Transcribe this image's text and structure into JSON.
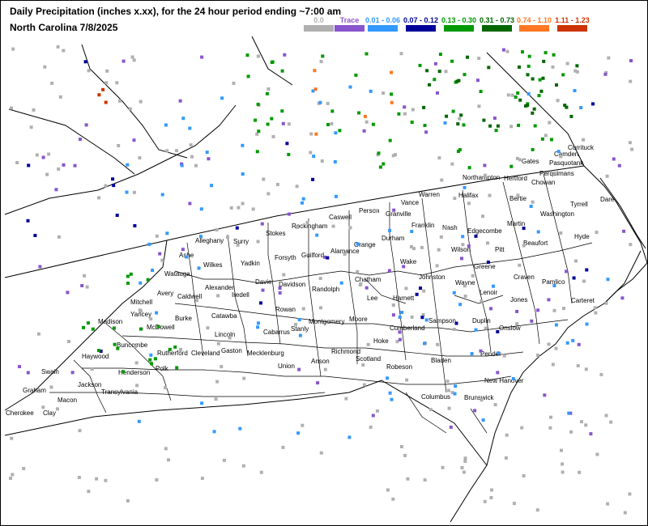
{
  "title": "Daily Precipitation (inches  x.xx),  for the 24 hour period ending ~7:00 am",
  "subtitle": "North Carolina 7/8/2025",
  "legend": [
    {
      "label": "0.0",
      "color": "#b0b0b0",
      "label_color": "#b0b0b0"
    },
    {
      "label": "Trace",
      "color": "#8855cc",
      "label_color": "#8855cc"
    },
    {
      "label": "0.01 - 0.06",
      "color": "#3399ff",
      "label_color": "#3399ff"
    },
    {
      "label": "0.07 - 0.12",
      "color": "#000099",
      "label_color": "#000099"
    },
    {
      "label": "0.13 - 0.30",
      "color": "#009900",
      "label_color": "#009900"
    },
    {
      "label": "0.31 - 0.73",
      "color": "#006600",
      "label_color": "#006600"
    },
    {
      "label": "0.74 - 1.10",
      "color": "#ff7722",
      "label_color": "#ff7722"
    },
    {
      "label": "1.11 - 1.23",
      "color": "#cc3300",
      "label_color": "#cc3300"
    }
  ],
  "counties": [
    "Currituck",
    "Camden",
    "Pasquotank",
    "Gates",
    "Perquimans",
    "Chowan",
    "Northampton",
    "Hertford",
    "Dare",
    "Warren",
    "Halifax",
    "Bertie",
    "Tyrrell",
    "Vance",
    "Washington",
    "Person",
    "Granville",
    "Caswell",
    "Rockingham",
    "Stokes",
    "Martin",
    "Franklin",
    "Nash",
    "Edgecombe",
    "Hyde",
    "Alleghany",
    "Surry",
    "Ashe",
    "Beaufort",
    "Durham",
    "Orange",
    "Alamance",
    "Guilford",
    "Forsyth",
    "Yadkin",
    "Wilkes",
    "Pitt",
    "Wilson",
    "Wake",
    "Watauga",
    "Greene",
    "Chatham",
    "Johnston",
    "Craven",
    "Pamlico",
    "Davie",
    "Davidson",
    "Avery",
    "Caldwell",
    "Alexander",
    "Iredell",
    "Randolph",
    "Wayne",
    "Lenoir",
    "Jones",
    "Carteret",
    "Lee",
    "Harnett",
    "Mitchell",
    "Burke",
    "Rowan",
    "Catawba",
    "Madison",
    "Yancey",
    "McDowell",
    "Moore",
    "Sampson",
    "Duplin",
    "Onslow",
    "Montgomery",
    "Cumberland",
    "Lincoln",
    "Cabarrus",
    "Stanly",
    "Buncombe",
    "Haywood",
    "Rutherford",
    "Cleveland",
    "Gaston",
    "Mecklenburg",
    "Hoke",
    "Richmond",
    "Pender",
    "Bladen",
    "Union",
    "Anson",
    "Scotland",
    "Robeson",
    "Henderson",
    "Polk",
    "Swain",
    "Jackson",
    "Graham",
    "Transylvania",
    "New Hanover",
    "Macon",
    "Columbus",
    "Brunswick",
    "Cherokee",
    "Clay"
  ]
}
